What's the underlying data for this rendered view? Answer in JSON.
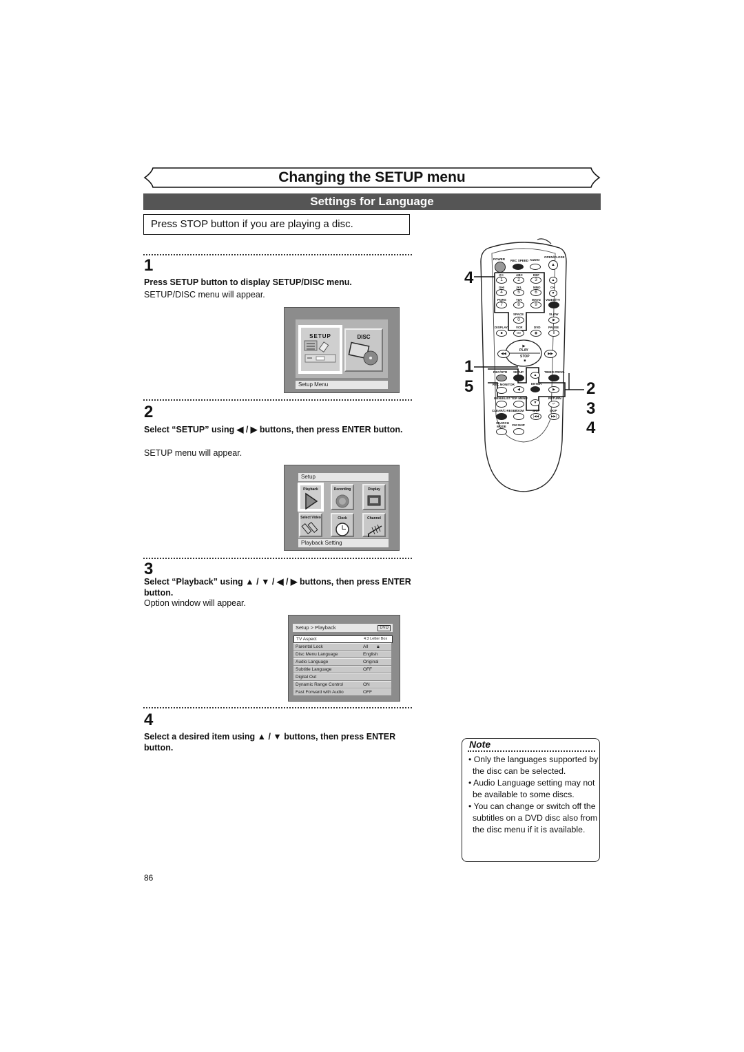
{
  "header": {
    "title": "Changing the SETUP menu",
    "section": "Settings for Language",
    "stop_notice": "Press STOP button if you are playing a disc."
  },
  "steps": [
    {
      "number": "1",
      "instruction": "Press SETUP button to display SETUP/DISC menu.",
      "result": "SETUP/DISC menu will appear."
    },
    {
      "number": "2",
      "instruction": "Select “SETUP” using ◀ / ▶ buttons, then press ENTER button.",
      "result": "SETUP menu will appear."
    },
    {
      "number": "3",
      "instruction": "Select “Playback” using ▲ / ▼ / ◀ / ▶ buttons, then press ENTER button.",
      "result": "Option window will appear."
    },
    {
      "number": "4",
      "instruction": "Select a desired item using ▲ / ▼ buttons, then press ENTER button.",
      "result": ""
    }
  ],
  "screen1": {
    "tiles": [
      {
        "label": "SETUP",
        "icon": "setup-sliders-icon",
        "selected": true
      },
      {
        "label": "DISC",
        "icon": "disc-film-icon",
        "selected": false
      }
    ],
    "status": "Setup Menu"
  },
  "screen2": {
    "header": "Setup",
    "tiles": [
      {
        "label": "Playback",
        "icon": "play-triangle-icon",
        "selected": true
      },
      {
        "label": "Recording",
        "icon": "record-circle-icon",
        "selected": false
      },
      {
        "label": "Display",
        "icon": "display-panel-icon",
        "selected": false
      },
      {
        "label": "Select Video",
        "icon": "video-cables-icon",
        "selected": false
      },
      {
        "label": "Clock",
        "icon": "clock-icon",
        "selected": false
      },
      {
        "label": "Channel",
        "icon": "antenna-icon",
        "selected": false
      }
    ],
    "status": "Playback Setting"
  },
  "screen3": {
    "breadcrumb": "Setup > Playback",
    "badge": "DVD",
    "rows": [
      {
        "label": "TV Aspect",
        "value": "4:3 Letter Box",
        "selected": true
      },
      {
        "label": "Parental Lock",
        "value": "All",
        "lock_icon": true
      },
      {
        "label": "Disc Menu Language",
        "value": "English"
      },
      {
        "label": "Audio Language",
        "value": "Original"
      },
      {
        "label": "Subtitle Language",
        "value": "OFF"
      },
      {
        "label": "Digital Out",
        "value": ""
      },
      {
        "label": "Dynamic Range Control",
        "value": "ON"
      },
      {
        "label": "Fast Forward with Audio",
        "value": "OFF"
      }
    ]
  },
  "remote": {
    "labels": {
      "power": "POWER",
      "rec_speed": "REC SPEED",
      "audio": "AUDIO",
      "open_close": "OPEN/CLOSE",
      "k1": "@!:",
      "k2": "ABC",
      "k3": "DEF",
      "k4": "GHI",
      "k5": "JKL",
      "k6": "MNO",
      "k7": "PQRS",
      "k8": "TUV",
      "k9": "WXYZ",
      "k0": "SPACE",
      "ch": "CH",
      "video_tv": "VIDEO/TV",
      "slow": "SLOW",
      "display": "DISPLAY",
      "vcr": "VCR",
      "dvd": "DVD",
      "pause": "PAUSE",
      "play": "PLAY",
      "stop": "STOP",
      "rec_otr": "REC/OTR",
      "setup": "SETUP",
      "timer_prog": "TIMER PROG.",
      "rec_monitor": "REC MONITOR",
      "enter": "ENTER",
      "menu_list": "MENU/LIST",
      "top_menu": "TOP MENU",
      "return": "RETURN",
      "clear_reset": "CLEAR/C-RESET",
      "zoom": "ZOOM",
      "skip_back": "SKIP",
      "skip_fwd": "SKIP",
      "search_mode": "SEARCH MODE",
      "cm_skip": "CM SKIP"
    },
    "digits": [
      "1",
      "2",
      "3",
      "4",
      "5",
      "6",
      "7",
      "8",
      "9",
      "0"
    ],
    "callouts": {
      "left_top": "4",
      "left_mid_a": "1",
      "left_mid_b": "5",
      "right_a": "2",
      "right_b": "3",
      "right_c": "4"
    }
  },
  "note": {
    "title": "Note",
    "items": [
      "Only the languages supported by the disc can be selected.",
      "Audio Language setting may not be available to some discs.",
      "You can change or switch off the subtitles on a DVD disc also from the disc menu if it is available."
    ]
  },
  "page_number": "86"
}
